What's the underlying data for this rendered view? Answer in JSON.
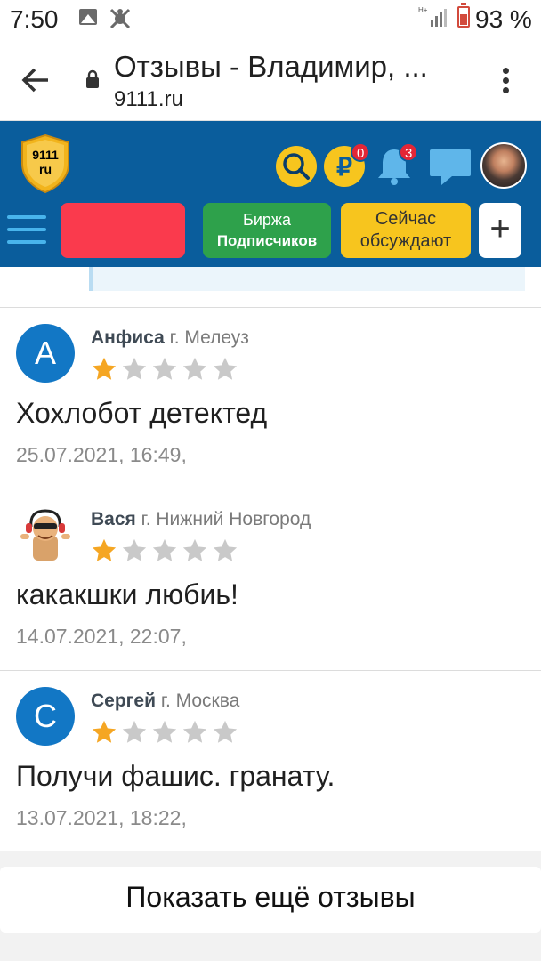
{
  "status_bar": {
    "time": "7:50",
    "network": "H+",
    "battery": "93 %"
  },
  "browser": {
    "title": "Отзывы - Владимир, ...",
    "domain": "9111.ru"
  },
  "site_header": {
    "logo_line1": "9111",
    "logo_line2": "ru",
    "coin_symbol": "₽",
    "coin_badge": "0",
    "bell_badge": "3",
    "nav": {
      "exchange_line1": "Биржа",
      "exchange_line2": "Подписчиков",
      "discussed_line1": "Сейчас",
      "discussed_line2": "обсуждают",
      "plus": "+"
    },
    "colors": {
      "header_bg": "#0a5d9c",
      "yellow": "#f7c51e",
      "green": "#2ea14b",
      "red": "#fa3a4d"
    }
  },
  "reviews": [
    {
      "initial": "А",
      "name": "Анфиса",
      "city": "г. Мелеуз",
      "rating": 1,
      "text": "Хохлобот детектед",
      "date": "25.07.2021, 16:49,"
    },
    {
      "initial": "",
      "name": "Вася",
      "city": "г. Нижний Новгород",
      "rating": 1,
      "text": "какакшки любиь!",
      "date": "14.07.2021, 22:07,"
    },
    {
      "initial": "С",
      "name": "Сергей",
      "city": "г. Москва",
      "rating": 1,
      "text": "Получи фашис. гранату.",
      "date": "13.07.2021, 18:22,"
    }
  ],
  "show_more": "Показать ещё отзывы"
}
